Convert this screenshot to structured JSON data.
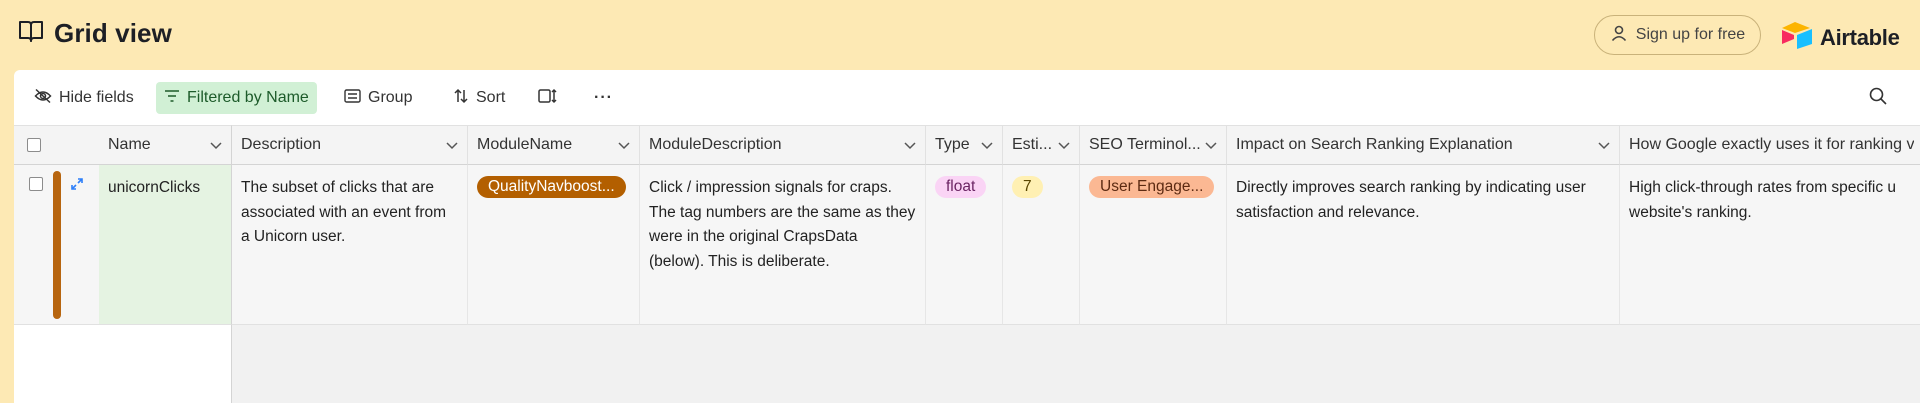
{
  "header": {
    "title": "Grid view",
    "signup_label": "Sign up for free",
    "brand_name": "Airtable"
  },
  "toolbar": {
    "hide_fields": "Hide fields",
    "filter": "Filtered by Name",
    "group": "Group",
    "sort": "Sort",
    "more": "···"
  },
  "columns": [
    {
      "key": "name",
      "label": "Name"
    },
    {
      "key": "description",
      "label": "Description"
    },
    {
      "key": "module_name",
      "label": "ModuleName"
    },
    {
      "key": "module_description",
      "label": "ModuleDescription"
    },
    {
      "key": "type",
      "label": "Type"
    },
    {
      "key": "estimate",
      "label": "Esti..."
    },
    {
      "key": "seo",
      "label": "SEO Terminol..."
    },
    {
      "key": "impact",
      "label": "Impact on Search Ranking Explanation"
    },
    {
      "key": "google",
      "label": "How Google exactly uses it for ranking v"
    }
  ],
  "row": {
    "name": "unicornClicks",
    "description": "The subset of clicks that are associated with an event from a Unicorn user.",
    "module_name": "QualityNavboost...",
    "module_description": "Click / impression signals for craps. The tag numbers are the same as they were in the original CrapsData (below). This is deliberate.",
    "type": "float",
    "estimate": "7",
    "seo": "User Engage...",
    "impact": "Directly improves search ranking by indicating user satisfaction and relevance.",
    "google": "High click-through rates from specific u website's ranking."
  },
  "colors": {
    "background": "#fde9b4",
    "filter_active_bg": "#d1f0d5",
    "row_color_bar": "#b7650f",
    "module_pill_bg": "#b35f00",
    "type_pill_bg": "#fad4f5",
    "estimate_pill_bg": "#fff0b3",
    "seo_pill_bg": "#fbb893",
    "name_cell_bg": "#e5f3e2"
  }
}
